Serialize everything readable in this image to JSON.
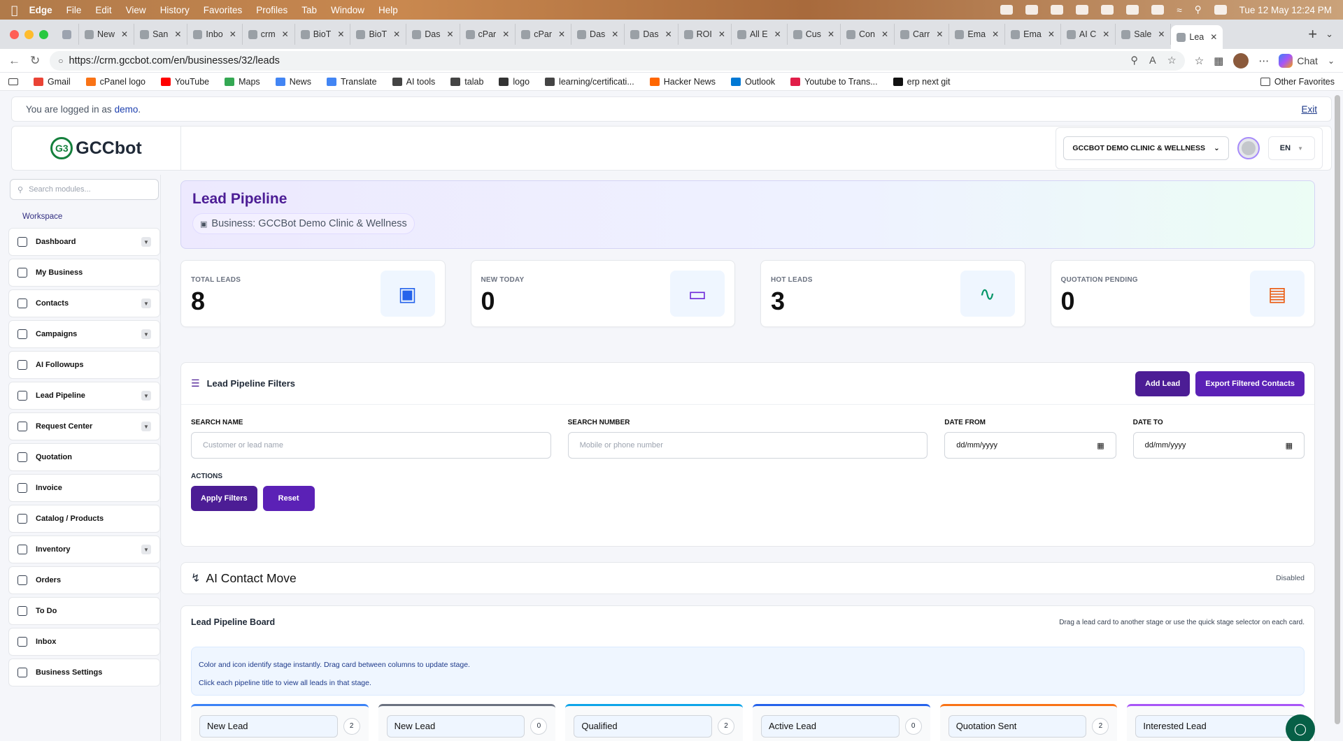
{
  "menubar": {
    "app": "Edge",
    "items": [
      "File",
      "Edit",
      "View",
      "History",
      "Favorites",
      "Profiles",
      "Tab",
      "Window",
      "Help"
    ],
    "datetime": "Tue 12 May  12:24 PM"
  },
  "tabs": [
    {
      "label": "New"
    },
    {
      "label": "San"
    },
    {
      "label": "Inbo"
    },
    {
      "label": "crm"
    },
    {
      "label": "BioT"
    },
    {
      "label": "BioT"
    },
    {
      "label": "Das"
    },
    {
      "label": "cPar"
    },
    {
      "label": "cPar"
    },
    {
      "label": "Das"
    },
    {
      "label": "Das"
    },
    {
      "label": "ROI"
    },
    {
      "label": "All E"
    },
    {
      "label": "Cus"
    },
    {
      "label": "Con"
    },
    {
      "label": "Carr"
    },
    {
      "label": "Ema"
    },
    {
      "label": "Ema"
    },
    {
      "label": "AI C"
    },
    {
      "label": "Sale"
    },
    {
      "label": "Lea"
    }
  ],
  "address": {
    "url": "https://crm.gccbot.com/en/businesses/32/leads",
    "chat": "Chat"
  },
  "bookmarks": [
    "Gmail",
    "cPanel logo",
    "YouTube",
    "Maps",
    "News",
    "Translate",
    "AI tools",
    "talab",
    "logo",
    "learning/certificati...",
    "Hacker News",
    "Outlook",
    "Youtube to Trans...",
    "erp next git"
  ],
  "other_favorites": "Other Favorites",
  "login": {
    "prefix": "You are logged in as",
    "user": "demo",
    "suffix": ".",
    "exit": "Exit"
  },
  "brand": {
    "name": "GCCbot",
    "mark": "G3"
  },
  "topbar": {
    "business_select": "GCCBOT DEMO CLINIC & WELLNESS",
    "lang": "EN"
  },
  "sidebar": {
    "search_placeholder": "Search modules...",
    "section": "Workspace",
    "items": [
      {
        "label": "Dashboard",
        "chevron": true
      },
      {
        "label": "My Business",
        "chevron": false
      },
      {
        "label": "Contacts",
        "chevron": true
      },
      {
        "label": "Campaigns",
        "chevron": true
      },
      {
        "label": "AI Followups",
        "chevron": false
      },
      {
        "label": "Lead Pipeline",
        "chevron": true
      },
      {
        "label": "Request Center",
        "chevron": true
      },
      {
        "label": "Quotation",
        "chevron": false
      },
      {
        "label": "Invoice",
        "chevron": false
      },
      {
        "label": "Catalog / Products",
        "chevron": false
      },
      {
        "label": "Inventory",
        "chevron": true
      },
      {
        "label": "Orders",
        "chevron": false
      },
      {
        "label": "To Do",
        "chevron": false
      },
      {
        "label": "Inbox",
        "chevron": false
      },
      {
        "label": "Business Settings",
        "chevron": false
      }
    ]
  },
  "hero": {
    "title": "Lead Pipeline",
    "business": "Business: GCCBot Demo Clinic & Wellness"
  },
  "stats": [
    {
      "label": "TOTAL LEADS",
      "value": "8",
      "icon": "briefcase-icon",
      "color": "#2563eb"
    },
    {
      "label": "NEW TODAY",
      "value": "0",
      "icon": "inbox-icon",
      "color": "#6d28d9"
    },
    {
      "label": "HOT LEADS",
      "value": "3",
      "icon": "activity-icon",
      "color": "#059669"
    },
    {
      "label": "QUOTATION PENDING",
      "value": "0",
      "icon": "document-icon",
      "color": "#ea580c"
    }
  ],
  "filters": {
    "title": "Lead Pipeline Filters",
    "add_lead": "Add Lead",
    "export": "Export Filtered Contacts",
    "search_name_label": "SEARCH NAME",
    "search_name_placeholder": "Customer or lead name",
    "search_number_label": "SEARCH NUMBER",
    "search_number_placeholder": "Mobile or phone number",
    "date_from_label": "DATE FROM",
    "date_from_value": "dd/mm/yyyy",
    "date_to_label": "DATE TO",
    "date_to_value": "dd/mm/yyyy",
    "actions_label": "ACTIONS",
    "apply": "Apply Filters",
    "reset": "Reset"
  },
  "ai_move": {
    "title": "AI Contact Move",
    "status": "Disabled"
  },
  "board": {
    "title": "Lead Pipeline Board",
    "hint": "Drag a lead card to another stage or use the quick stage selector on each card.",
    "note1": "Color and icon identify stage instantly. Drag card between columns to update stage.",
    "note2": "Click each pipeline title to view all leads in that stage.",
    "columns": [
      {
        "name": "New Lead",
        "count": "2",
        "color": "#3b82f6"
      },
      {
        "name": "New Lead",
        "count": "0",
        "color": "#6b7280"
      },
      {
        "name": "Qualified",
        "count": "2",
        "color": "#0ea5e9"
      },
      {
        "name": "Active Lead",
        "count": "0",
        "color": "#2563eb"
      },
      {
        "name": "Quotation Sent",
        "count": "2",
        "color": "#f97316"
      },
      {
        "name": "Interested Lead",
        "count": "",
        "color": "#a855f7"
      }
    ]
  }
}
